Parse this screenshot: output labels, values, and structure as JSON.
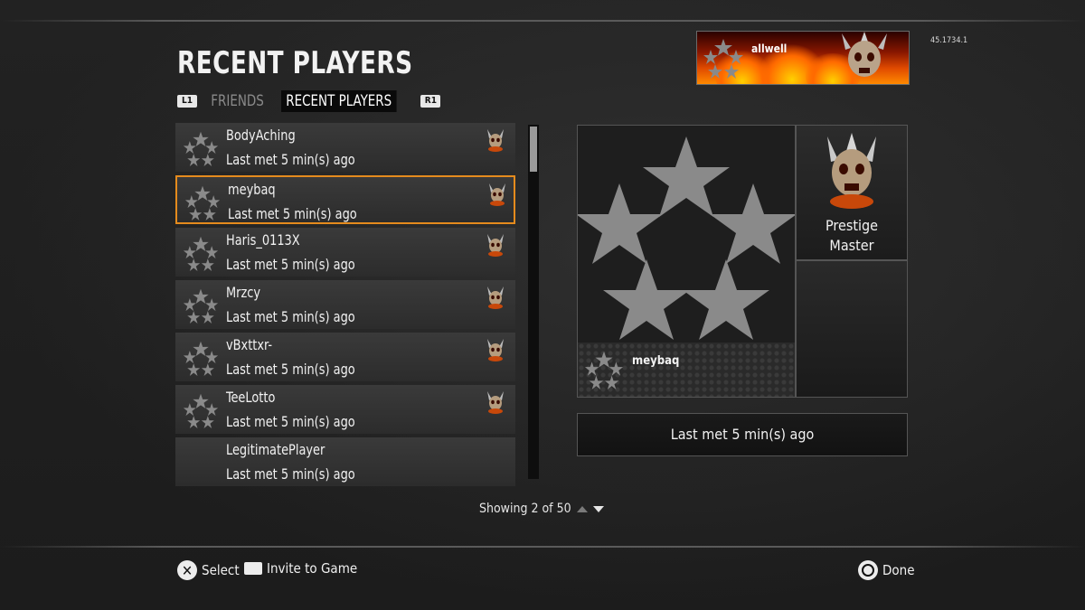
{
  "header": {
    "title": "RECENT PLAYERS",
    "version": "45.1734.1"
  },
  "tabs": {
    "left_bumper": "L1",
    "right_bumper": "R1",
    "items": [
      {
        "label": "FRIENDS",
        "active": false
      },
      {
        "label": "RECENT PLAYERS",
        "active": true
      }
    ]
  },
  "callsign": {
    "name": "allwell"
  },
  "players": [
    {
      "name": "BodyAching",
      "last_met": "Last met 5 min(s) ago",
      "has_rank_icon": true,
      "selected": false
    },
    {
      "name": "meybaq",
      "last_met": "Last met 5 min(s) ago",
      "has_rank_icon": true,
      "selected": true
    },
    {
      "name": "Haris_0113X",
      "last_met": "Last met 5 min(s) ago",
      "has_rank_icon": true,
      "selected": false
    },
    {
      "name": "Mrzcy",
      "last_met": "Last met 5 min(s) ago",
      "has_rank_icon": true,
      "selected": false
    },
    {
      "name": "vBxttxr-",
      "last_met": "Last met 5 min(s) ago",
      "has_rank_icon": true,
      "selected": false
    },
    {
      "name": "TeeLotto",
      "last_met": "Last met 5 min(s) ago",
      "has_rank_icon": true,
      "selected": false
    },
    {
      "name": "LegitimatePlayer",
      "last_met": "Last met 5 min(s) ago",
      "has_rank_icon": false,
      "selected": false
    }
  ],
  "details": {
    "emblem_name": "meybaq",
    "prestige_label": "Prestige\nMaster",
    "last_met": "Last met 5 min(s) ago"
  },
  "pagination": {
    "text": "Showing 2 of 50"
  },
  "footer": {
    "select_label": "Select",
    "invite_label": "Invite to Game",
    "done_label": "Done"
  },
  "colors": {
    "selection": "#e58b1d",
    "panel_border": "#555555"
  }
}
